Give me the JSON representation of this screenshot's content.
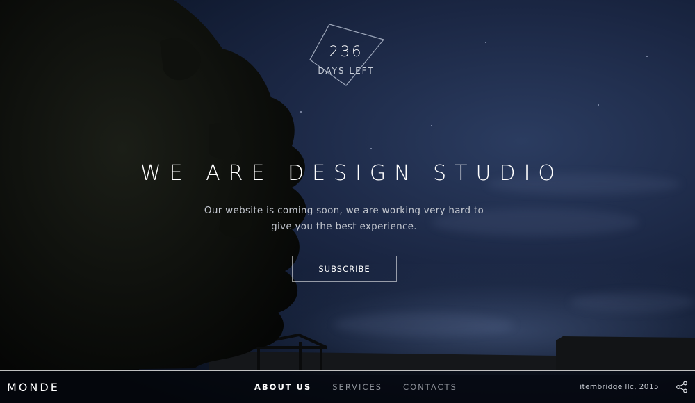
{
  "countdown": {
    "number": "236",
    "label": "DAYS LEFT"
  },
  "hero": {
    "headline": "WE ARE DESIGN STUDIO",
    "subtext": "Our website is coming soon, we are working very hard to give you the best experience.",
    "subscribe_label": "SUBSCRIBE"
  },
  "footer": {
    "brand": "MONDE",
    "nav": [
      {
        "label": "ABOUT US",
        "active": true
      },
      {
        "label": "SERVICES",
        "active": false
      },
      {
        "label": "CONTACTS",
        "active": false
      }
    ],
    "copyright": "itembridge llc, 2015",
    "share_icon": "share-icon"
  },
  "colors": {
    "sky": "#1b2744",
    "text_primary": "#ffffff",
    "nav_inactive": "#8b8f97"
  }
}
